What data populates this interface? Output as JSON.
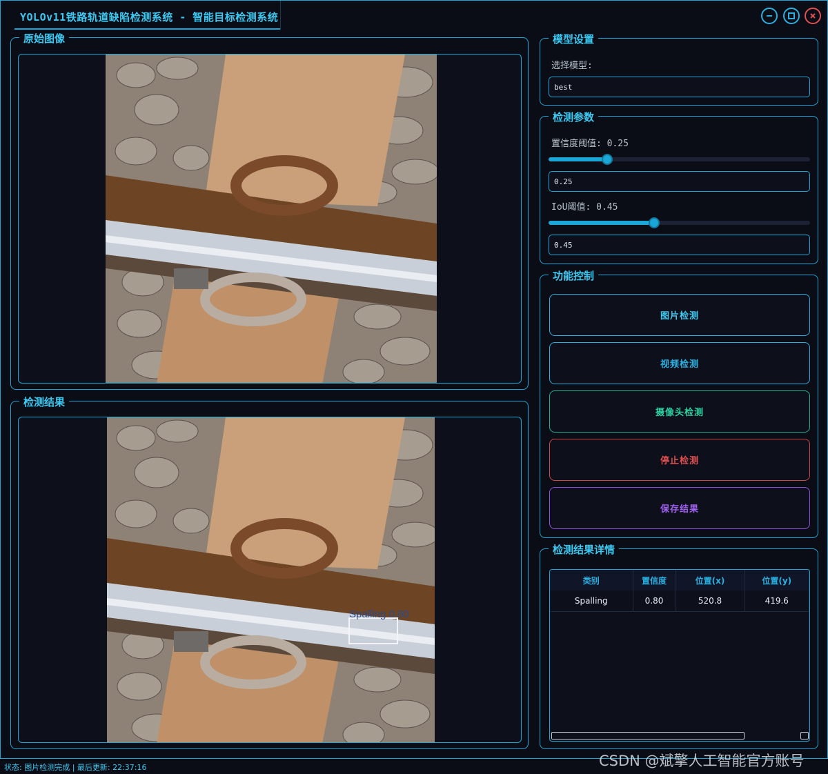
{
  "window": {
    "title": "YOLOv11铁路轨道缺陷检测系统 - 智能目标检测系统"
  },
  "original_panel": {
    "title": "原始图像"
  },
  "result_panel": {
    "title": "检测结果",
    "box_label": "Spalling 0.80"
  },
  "model_settings": {
    "title": "模型设置",
    "select_label": "选择模型:",
    "model_value": "best"
  },
  "detect_params": {
    "title": "检测参数",
    "conf_label": "置信度阈值: 0.25",
    "conf_value": "0.25",
    "conf_level": 0.25,
    "iou_label": "IoU阈值: 0.45",
    "iou_value": "0.45",
    "iou_level": 0.45
  },
  "controls": {
    "title": "功能控制",
    "image_detect": "图片检测",
    "video_detect": "视频检测",
    "camera_detect": "摄像头检测",
    "stop_detect": "停止检测",
    "save_result": "保存结果"
  },
  "results": {
    "title": "检测结果详情",
    "columns": [
      "类别",
      "置信度",
      "位置(x)",
      "位置(y)"
    ],
    "rows": [
      [
        "Spalling",
        "0.80",
        "520.8",
        "419.6"
      ]
    ]
  },
  "status": {
    "text": "状态: 图片检测完成 | 最后更新: 22:37:16"
  },
  "watermark": "CSDN @斌擎人工智能官方账号",
  "colors": {
    "accent": "#1aa6d6",
    "title": "#3cc8f0",
    "image_btn": "#3cc8f0",
    "video_btn": "#2ab0e0",
    "camera_btn": "#2ed0a0",
    "stop_btn": "#e05050",
    "save_btn": "#a060f0"
  }
}
